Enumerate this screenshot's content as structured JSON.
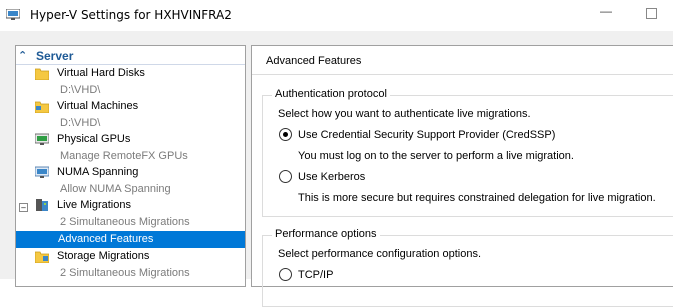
{
  "window": {
    "title": "Hyper-V Settings for HXHVINFRA2",
    "icons": [
      "hyperv-app-icon",
      "minimize-icon",
      "maximize-icon"
    ]
  },
  "tree": {
    "header": "Server",
    "items": [
      {
        "label": "Virtual Hard Disks",
        "sub": "D:\\VHD\\",
        "icon": "folder-icon"
      },
      {
        "label": "Virtual Machines",
        "sub": "D:\\VHD\\",
        "icon": "folder-vm-icon"
      },
      {
        "label": "Physical GPUs",
        "sub": "Manage RemoteFX GPUs",
        "icon": "gpu-icon"
      },
      {
        "label": "NUMA Spanning",
        "sub": "Allow NUMA Spanning",
        "icon": "numa-icon"
      },
      {
        "label": "Live Migrations",
        "sub": "2 Simultaneous Migrations",
        "icon": "live-migration-icon"
      },
      {
        "label": "Advanced Features"
      },
      {
        "label": "Storage Migrations",
        "sub": "2 Simultaneous Migrations",
        "icon": "storage-migration-icon"
      }
    ]
  },
  "panel": {
    "title": "Advanced Features",
    "auth": {
      "title": "Authentication protocol",
      "desc": "Select how you want to authenticate live migrations.",
      "opt1": "Use Credential Security Support Provider (CredSSP)",
      "opt1_note": "You must log on to the server to perform a live migration.",
      "opt2": "Use Kerberos",
      "opt2_note": "This is more secure but requires constrained delegation for live migration."
    },
    "perf": {
      "title": "Performance options",
      "desc": "Select performance configuration options.",
      "opt1": "TCP/IP"
    }
  },
  "colors": {
    "selection": "#0078d7",
    "header_text": "#1e5a96",
    "muted_text": "#7b7b7b"
  }
}
